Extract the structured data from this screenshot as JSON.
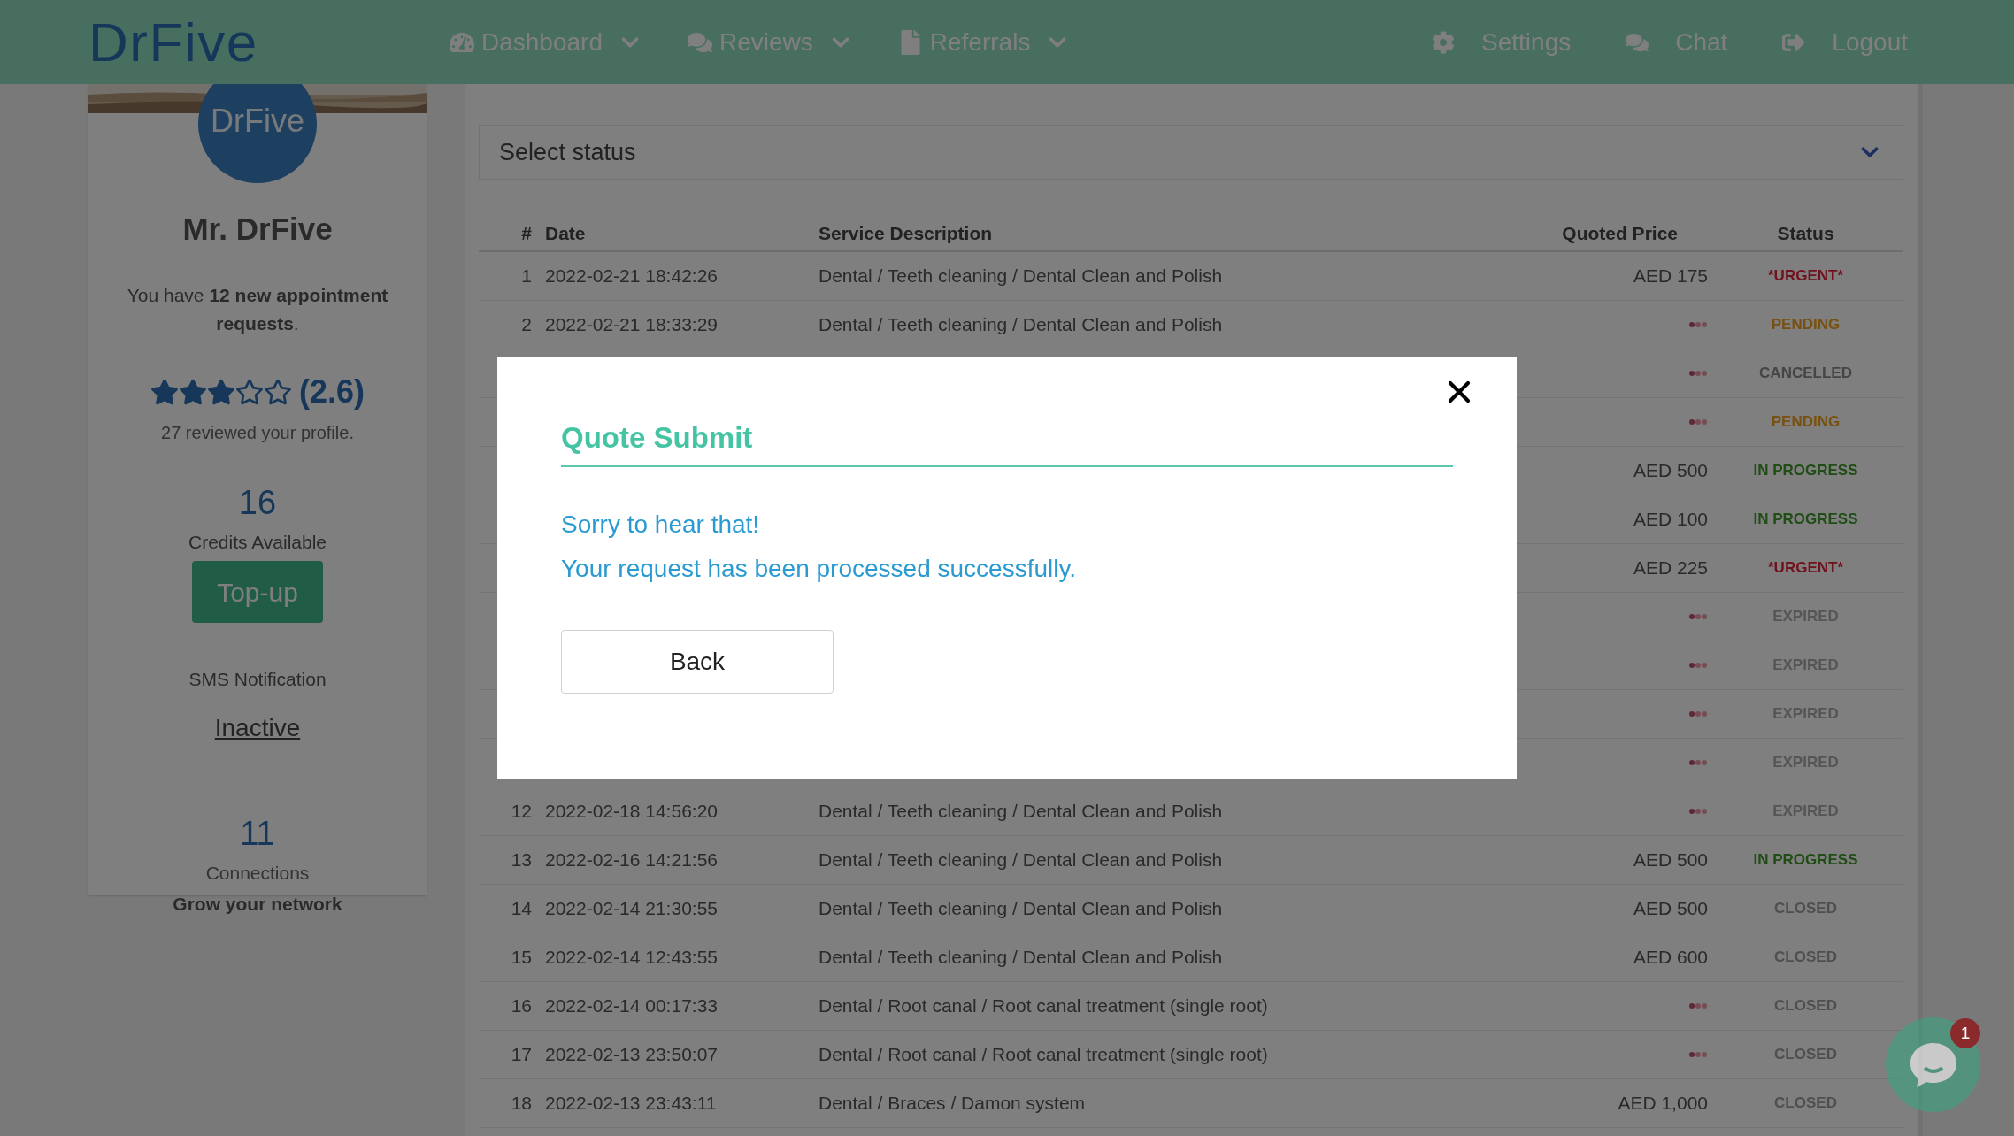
{
  "header": {
    "logo": "DrFive",
    "nav": [
      {
        "label": "Dashboard"
      },
      {
        "label": "Reviews"
      },
      {
        "label": "Referrals"
      }
    ],
    "right": [
      {
        "label": "Settings"
      },
      {
        "label": "Chat"
      },
      {
        "label": "Logout"
      }
    ]
  },
  "profile": {
    "avatar": "DrFive",
    "name": "Mr. DrFive",
    "requests": "You have **12 new appointment requests**.",
    "stars": 3,
    "rating": "(2.6)",
    "reviews": "27 reviewed your profile.",
    "credits": "16",
    "credits_label": "Credits Available",
    "topup": "Top-up",
    "sms_label": "SMS Notification",
    "sms_status": "Inactive",
    "connections": "11",
    "connections_label": "Connections",
    "grow": "Grow your network"
  },
  "filter": {
    "placeholder": "Select status"
  },
  "table": {
    "columns": [
      "#",
      "Date",
      "Service Description",
      "Quoted Price",
      "Status"
    ],
    "rows": [
      {
        "number": "1",
        "date": "2022-02-21 18:42:26",
        "service": "Dental / Teeth cleaning / Dental Clean and Polish",
        "price": "AED 175",
        "status": "*URGENT*",
        "kind": "urgent"
      },
      {
        "number": "2",
        "date": "2022-02-21 18:33:29",
        "service": "Dental / Teeth cleaning / Dental Clean and Polish",
        "status": "PENDING",
        "kind": "pending"
      },
      {
        "status": "CANCELLED",
        "kind": "cancelled"
      },
      {
        "status": "PENDING",
        "kind": "pending"
      },
      {
        "price": "AED 500",
        "status": "IN PROGRESS",
        "kind": "in_progress"
      },
      {
        "price": "AED 100",
        "status": "IN PROGRESS",
        "kind": "in_progress"
      },
      {
        "price": "AED 225",
        "status": "*URGENT*",
        "kind": "urgent"
      },
      {
        "status": "EXPIRED",
        "kind": "expired"
      },
      {
        "status": "EXPIRED",
        "kind": "expired"
      },
      {
        "status": "EXPIRED",
        "kind": "expired"
      },
      {
        "status": "EXPIRED",
        "kind": "expired"
      },
      {
        "number": "12",
        "date": "2022-02-18 14:56:20",
        "service": "Dental / Teeth cleaning / Dental Clean and Polish",
        "status": "EXPIRED",
        "kind": "expired"
      },
      {
        "number": "13",
        "date": "2022-02-16 14:21:56",
        "service": "Dental / Teeth cleaning / Dental Clean and Polish",
        "price": "AED 500",
        "status": "IN PROGRESS",
        "kind": "in_progress"
      },
      {
        "number": "14",
        "date": "2022-02-14 21:30:55",
        "service": "Dental / Teeth cleaning / Dental Clean and Polish",
        "price": "AED 500",
        "status": "CLOSED",
        "kind": "closed"
      },
      {
        "number": "15",
        "date": "2022-02-14 12:43:55",
        "service": "Dental / Teeth cleaning / Dental Clean and Polish",
        "price": "AED 600",
        "status": "CLOSED",
        "kind": "closed"
      },
      {
        "number": "16",
        "date": "2022-02-14 00:17:33",
        "service": "Dental / Root canal / Root canal treatment (single root)",
        "status": "CLOSED",
        "kind": "closed"
      },
      {
        "number": "17",
        "date": "2022-02-13 23:50:07",
        "service": "Dental / Root canal / Root canal treatment (single root)",
        "status": "CLOSED",
        "kind": "closed"
      },
      {
        "number": "18",
        "date": "2022-02-13 23:43:11",
        "service": "Dental / Braces / Damon system",
        "price": "AED 1,000",
        "status": "CLOSED",
        "kind": "closed"
      }
    ]
  },
  "chat_widget": {
    "badge": "1"
  },
  "modal": {
    "title": "Quote Submit",
    "messages": [
      "Sorry to hear that!",
      "Your request has been processed successfully."
    ],
    "button": "Back"
  }
}
